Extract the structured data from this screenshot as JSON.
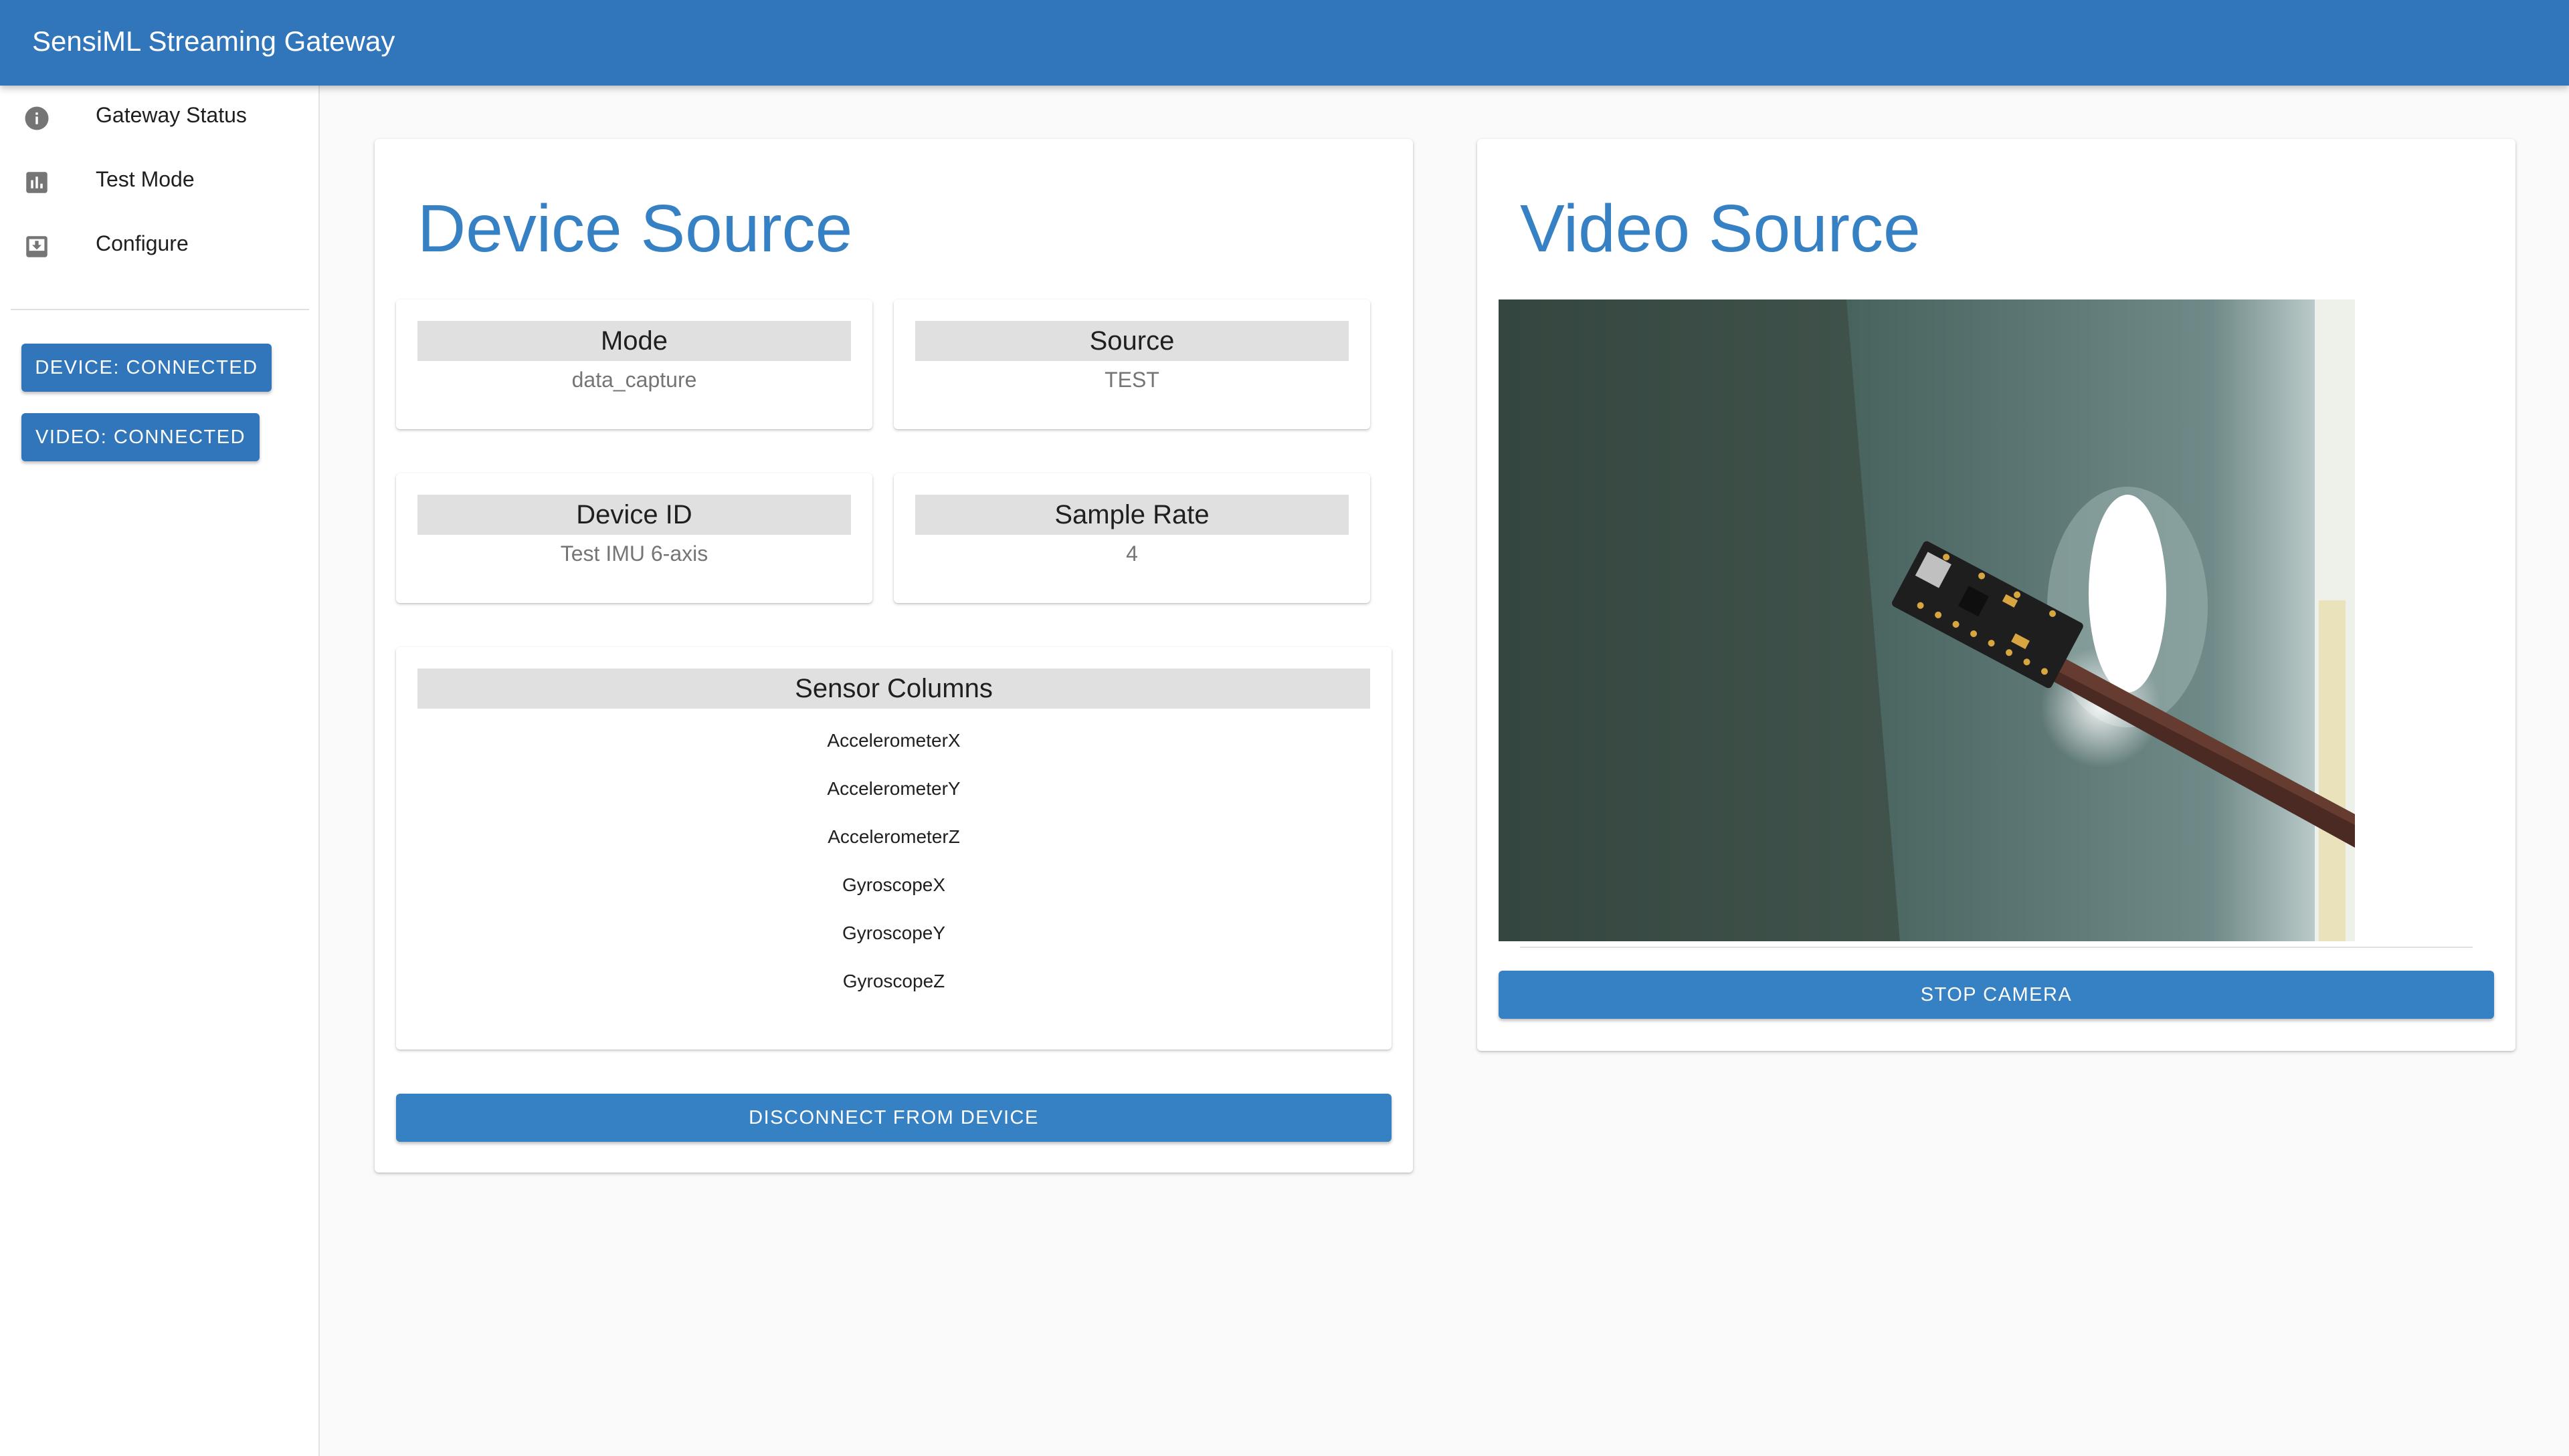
{
  "app": {
    "title": "SensiML Streaming Gateway"
  },
  "sidebar": {
    "items": [
      {
        "label": "Gateway Status",
        "icon": "info-icon"
      },
      {
        "label": "Test Mode",
        "icon": "bar-chart-icon"
      },
      {
        "label": "Configure",
        "icon": "download-box-icon"
      }
    ],
    "device_status": "DEVICE: CONNECTED",
    "video_status": "VIDEO: CONNECTED"
  },
  "device_source": {
    "title": "Device Source",
    "fields": [
      {
        "label": "Mode",
        "value": "data_capture"
      },
      {
        "label": "Source",
        "value": "TEST"
      },
      {
        "label": "Device ID",
        "value": "Test IMU 6-axis"
      },
      {
        "label": "Sample Rate",
        "value": "4"
      }
    ],
    "sensor_columns_label": "Sensor Columns",
    "sensor_columns": [
      "AccelerometerX",
      "AccelerometerY",
      "AccelerometerZ",
      "GyroscopeX",
      "GyroscopeY",
      "GyroscopeZ"
    ],
    "disconnect_label": "DISCONNECT FROM DEVICE"
  },
  "video_source": {
    "title": "Video Source",
    "stop_label": "STOP CAMERA"
  },
  "colors": {
    "appbar": "#3176bb",
    "accent": "#3680c4",
    "header_gray": "#e0e0e0",
    "background": "#fafafa"
  }
}
